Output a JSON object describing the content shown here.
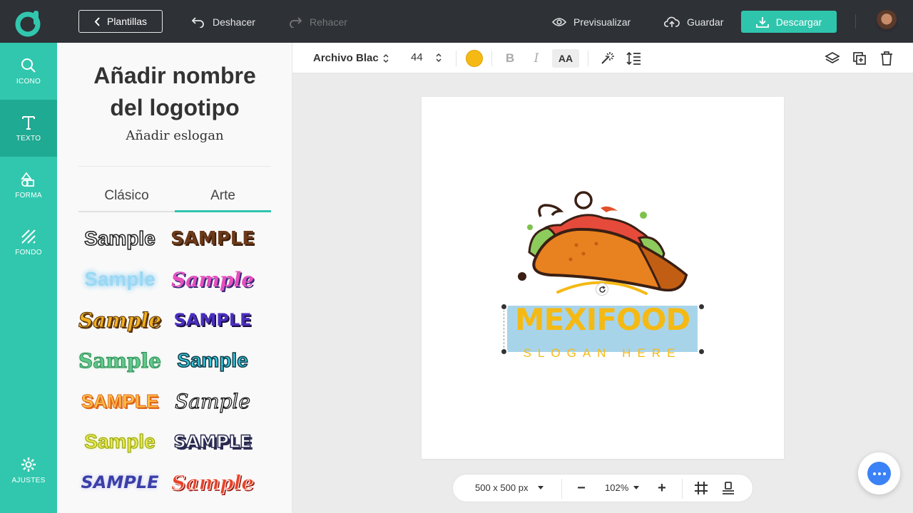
{
  "header": {
    "templates_label": "Plantillas",
    "undo_label": "Deshacer",
    "redo_label": "Rehacer",
    "preview_label": "Previsualizar",
    "save_label": "Guardar",
    "download_label": "Descargar"
  },
  "rail": {
    "items": [
      {
        "label": "ICONO",
        "icon": "search-icon"
      },
      {
        "label": "TEXTO",
        "icon": "text-icon"
      },
      {
        "label": "FORMA",
        "icon": "shapes-icon"
      },
      {
        "label": "FONDO",
        "icon": "background-icon"
      },
      {
        "label": "AJUSTES",
        "icon": "gear-icon"
      }
    ]
  },
  "panel": {
    "title_line1": "Añadir nombre",
    "title_line2": "del logotipo",
    "slogan": "Añadir eslogan",
    "tabs": [
      "Clásico",
      "Arte"
    ],
    "active_tab": "Arte",
    "samples": [
      "Sample",
      "SAMPLE",
      "Sample",
      "Sample",
      "Sample",
      "SAMPLE",
      "Sample",
      "Sample",
      "SAMPLE",
      "Sample",
      "Sample",
      "SAMPLE",
      "SAMPLE",
      "Sample"
    ]
  },
  "toolbar": {
    "font_name": "Archivo Blac",
    "font_size": "44",
    "text_color": "#f5b914",
    "bold_label": "B",
    "italic_label": "I",
    "case_label": "AA"
  },
  "canvas": {
    "brand_name": "MEXIFOOD",
    "slogan": "SLOGAN HERE",
    "brand_color": "#f5b914"
  },
  "bottombar": {
    "canvas_size": "500 x 500 px",
    "zoom": "102%",
    "zoom_out": "−",
    "zoom_in": "+"
  },
  "colors": {
    "accent": "#31c7ae",
    "topbar": "#2e3136"
  }
}
